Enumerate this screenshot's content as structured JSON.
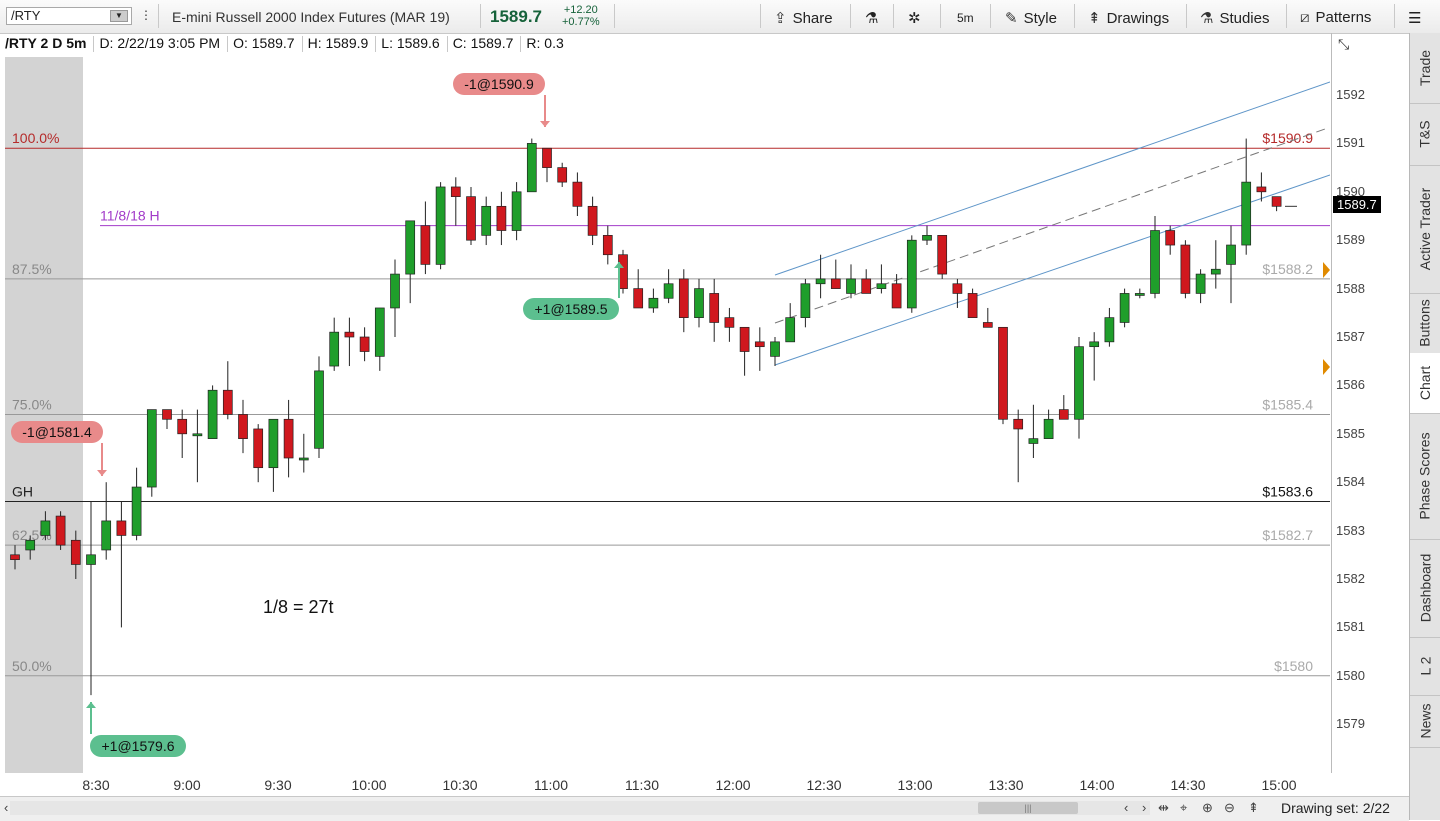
{
  "toolbar": {
    "symbol": "/RTY",
    "description": "E-mini Russell 2000 Index Futures (MAR 19)",
    "last": "1589.7",
    "change": "+12.20",
    "change_pct": "+0.77%",
    "share": "Share",
    "timeframe": "5m",
    "style": "Style",
    "drawings": "Drawings",
    "studies": "Studies",
    "patterns": "Patterns"
  },
  "info": {
    "symbol": "/RTY 2 D 5m",
    "date": "D: 2/22/19 3:05 PM",
    "open": "O: 1589.7",
    "high": "H: 1589.9",
    "low": "L: 1589.6",
    "close": "C: 1589.7",
    "range": "R: 0.3"
  },
  "price_axis": [
    "1592",
    "1591",
    "1590",
    "1589",
    "1588",
    "1587",
    "1586",
    "1585",
    "1584",
    "1583",
    "1582",
    "1581",
    "1580",
    "1579"
  ],
  "last_price_marker": "1589.7",
  "time_axis": [
    "8:30",
    "9:00",
    "9:30",
    "10:00",
    "10:30",
    "11:00",
    "11:30",
    "12:00",
    "12:30",
    "13:00",
    "13:30",
    "14:00",
    "14:30",
    "15:00"
  ],
  "levels": {
    "fib100": {
      "left": "100.0%",
      "right": "$1590.9",
      "value": 1590.9
    },
    "swing_high": {
      "left": "11/8/18 H",
      "value": 1589.3
    },
    "fib875": {
      "left": "87.5%",
      "right": "$1588.2",
      "value": 1588.2
    },
    "fib75": {
      "left": "75.0%",
      "right": "$1585.4",
      "value": 1585.4
    },
    "gh": {
      "left": "GH",
      "right": "$1583.6",
      "value": 1583.6
    },
    "fib625": {
      "left": "62.5%",
      "right": "$1582.7",
      "value": 1582.7
    },
    "fib50": {
      "left": "50.0%",
      "right": "$1580",
      "value": 1580.0
    }
  },
  "trades": [
    {
      "label": "-1@1590.9",
      "type": "sell"
    },
    {
      "label": "+1@1589.5",
      "type": "buy"
    },
    {
      "label": "-1@1581.4",
      "type": "sell"
    },
    {
      "label": "+1@1579.6",
      "type": "buy"
    }
  ],
  "note": "1/8 = 27t",
  "colors": {
    "up": "#1f9e2b",
    "down": "#d0181e",
    "fib100": "#b52a2a",
    "swing": "#a23bc9",
    "channel": "#5e95c8",
    "buy": "#5cbf8f",
    "sell": "#e88a8a"
  },
  "candles": [
    [
      1582.5,
      1582.7,
      1582.2,
      1582.4
    ],
    [
      1582.6,
      1582.9,
      1582.4,
      1582.8
    ],
    [
      1582.9,
      1583.4,
      1582.8,
      1583.2
    ],
    [
      1583.3,
      1583.4,
      1582.6,
      1582.7
    ],
    [
      1582.8,
      1583.0,
      1582.0,
      1582.3
    ],
    [
      1582.3,
      1583.6,
      1579.6,
      1582.5
    ],
    [
      1582.6,
      1584.0,
      1582.4,
      1583.2
    ],
    [
      1583.2,
      1583.6,
      1581.0,
      1582.9
    ],
    [
      1582.9,
      1584.3,
      1582.8,
      1583.9
    ],
    [
      1583.9,
      1585.5,
      1583.7,
      1585.5
    ],
    [
      1585.5,
      1585.5,
      1585.1,
      1585.3
    ],
    [
      1585.3,
      1585.5,
      1584.5,
      1585.0
    ],
    [
      1585.0,
      1585.5,
      1584.0,
      1585.0
    ],
    [
      1584.9,
      1586.0,
      1584.9,
      1585.9
    ],
    [
      1585.9,
      1586.5,
      1585.3,
      1585.4
    ],
    [
      1585.4,
      1585.7,
      1584.6,
      1584.9
    ],
    [
      1585.1,
      1585.2,
      1584.0,
      1584.3
    ],
    [
      1584.3,
      1585.3,
      1583.8,
      1585.3
    ],
    [
      1585.3,
      1585.7,
      1584.1,
      1584.5
    ],
    [
      1584.5,
      1585.0,
      1584.2,
      1584.5
    ],
    [
      1584.7,
      1586.6,
      1584.5,
      1586.3
    ],
    [
      1586.4,
      1587.4,
      1586.3,
      1587.1
    ],
    [
      1587.1,
      1587.4,
      1586.4,
      1587.0
    ],
    [
      1587.0,
      1587.2,
      1586.5,
      1586.7
    ],
    [
      1586.6,
      1587.6,
      1586.3,
      1587.6
    ],
    [
      1587.6,
      1588.6,
      1587.0,
      1588.3
    ],
    [
      1588.3,
      1589.4,
      1587.7,
      1589.4
    ],
    [
      1589.3,
      1589.8,
      1588.3,
      1588.5
    ],
    [
      1588.5,
      1590.2,
      1588.4,
      1590.1
    ],
    [
      1590.1,
      1590.3,
      1589.3,
      1589.9
    ],
    [
      1589.9,
      1590.1,
      1588.9,
      1589.0
    ],
    [
      1589.1,
      1589.9,
      1588.9,
      1589.7
    ],
    [
      1589.7,
      1590.0,
      1588.9,
      1589.2
    ],
    [
      1589.2,
      1590.2,
      1589.0,
      1590.0
    ],
    [
      1590.0,
      1591.1,
      1590.0,
      1591.0
    ],
    [
      1590.9,
      1590.9,
      1590.2,
      1590.5
    ],
    [
      1590.5,
      1590.6,
      1590.1,
      1590.2
    ],
    [
      1590.2,
      1590.4,
      1589.5,
      1589.7
    ],
    [
      1589.7,
      1589.9,
      1588.9,
      1589.1
    ],
    [
      1589.1,
      1589.3,
      1588.5,
      1588.7
    ],
    [
      1588.7,
      1588.8,
      1587.9,
      1588.0
    ],
    [
      1588.0,
      1588.4,
      1587.6,
      1587.6
    ],
    [
      1587.6,
      1588.0,
      1587.5,
      1587.8
    ],
    [
      1587.8,
      1588.4,
      1587.7,
      1588.1
    ],
    [
      1588.2,
      1588.4,
      1587.1,
      1587.4
    ],
    [
      1587.4,
      1588.2,
      1587.2,
      1588.0
    ],
    [
      1587.9,
      1588.2,
      1586.9,
      1587.3
    ],
    [
      1587.4,
      1587.6,
      1586.9,
      1587.2
    ],
    [
      1587.2,
      1587.2,
      1586.2,
      1586.7
    ],
    [
      1586.9,
      1587.2,
      1586.3,
      1586.8
    ],
    [
      1586.6,
      1587.0,
      1586.4,
      1586.9
    ],
    [
      1586.9,
      1587.7,
      1586.9,
      1587.4
    ],
    [
      1587.4,
      1588.2,
      1587.2,
      1588.1
    ],
    [
      1588.1,
      1588.7,
      1587.8,
      1588.2
    ],
    [
      1588.2,
      1588.6,
      1588.0,
      1588.0
    ],
    [
      1587.9,
      1588.5,
      1587.8,
      1588.2
    ],
    [
      1588.2,
      1588.4,
      1587.9,
      1587.9
    ],
    [
      1588.0,
      1588.5,
      1587.9,
      1588.1
    ],
    [
      1588.1,
      1588.3,
      1587.6,
      1587.6
    ],
    [
      1587.6,
      1589.1,
      1587.5,
      1589.0
    ],
    [
      1589.0,
      1589.3,
      1588.9,
      1589.1
    ],
    [
      1589.1,
      1589.1,
      1588.2,
      1588.3
    ],
    [
      1588.1,
      1588.2,
      1587.6,
      1587.9
    ],
    [
      1587.9,
      1588.0,
      1587.4,
      1587.4
    ],
    [
      1587.3,
      1587.6,
      1587.2,
      1587.2
    ],
    [
      1587.2,
      1587.2,
      1585.2,
      1585.3
    ],
    [
      1585.3,
      1585.5,
      1584.0,
      1585.1
    ],
    [
      1584.8,
      1585.6,
      1584.5,
      1584.9
    ],
    [
      1584.9,
      1585.5,
      1584.9,
      1585.3
    ],
    [
      1585.5,
      1585.8,
      1585.3,
      1585.3
    ],
    [
      1585.3,
      1587.0,
      1584.9,
      1586.8
    ],
    [
      1586.8,
      1587.1,
      1586.1,
      1586.9
    ],
    [
      1586.9,
      1587.6,
      1586.8,
      1587.4
    ],
    [
      1587.3,
      1588.0,
      1587.2,
      1587.9
    ],
    [
      1587.9,
      1588.0,
      1587.8,
      1587.9
    ],
    [
      1587.9,
      1589.5,
      1587.8,
      1589.2
    ],
    [
      1589.2,
      1589.3,
      1588.7,
      1588.9
    ],
    [
      1588.9,
      1589.0,
      1587.8,
      1587.9
    ],
    [
      1587.9,
      1588.4,
      1587.7,
      1588.3
    ],
    [
      1588.3,
      1589.0,
      1588.0,
      1588.4
    ],
    [
      1588.5,
      1589.3,
      1587.7,
      1588.9
    ],
    [
      1588.9,
      1591.1,
      1588.7,
      1590.2
    ],
    [
      1590.1,
      1590.4,
      1589.8,
      1590.0
    ],
    [
      1589.9,
      1589.9,
      1589.6,
      1589.7
    ]
  ],
  "right_tabs": [
    "Trade",
    "T&S",
    "Active Trader",
    "Buttons",
    "Chart",
    "Phase Scores",
    "Dashboard",
    "L 2",
    "News"
  ],
  "bottom": {
    "drawing_set": "Drawing set: 2/22"
  }
}
